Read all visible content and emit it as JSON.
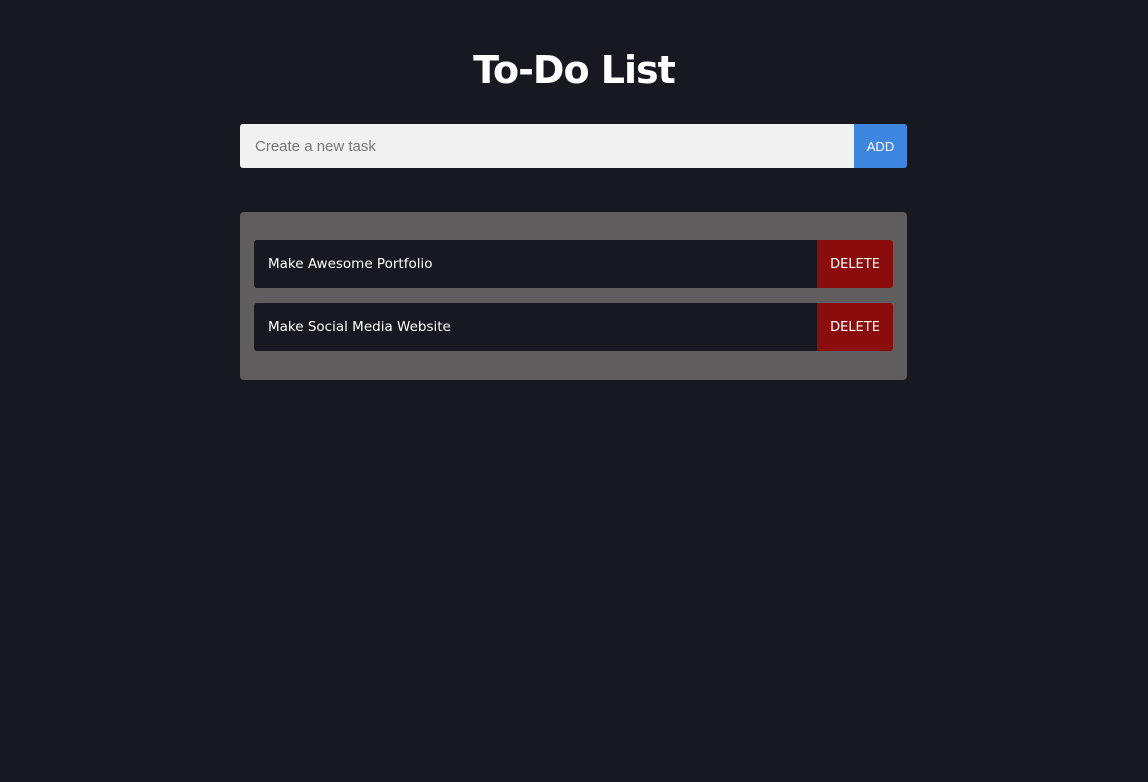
{
  "header": {
    "title": "To-Do List"
  },
  "add_form": {
    "placeholder": "Create a new task",
    "value": "",
    "add_label": "ADD"
  },
  "tasks": [
    {
      "text": "Make Awesome Portfolio",
      "delete_label": "DELETE"
    },
    {
      "text": "Make Social Media Website",
      "delete_label": "DELETE"
    }
  ],
  "colors": {
    "background": "#181820",
    "panel": "#5f5d5e",
    "add_button": "#3f86e0",
    "delete_button": "#8a0c0c",
    "input_background": "#f1f1f1"
  }
}
